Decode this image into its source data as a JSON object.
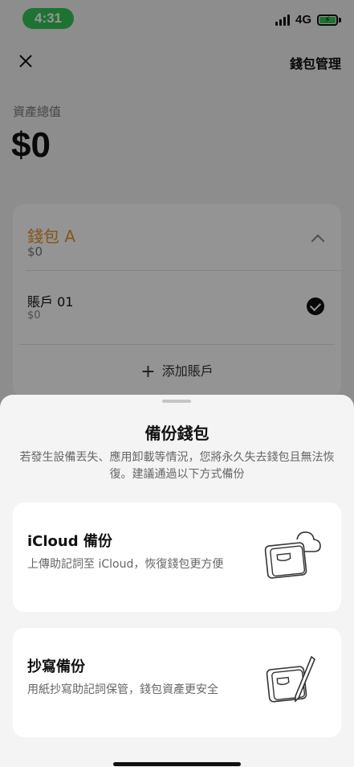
{
  "status_bar": {
    "time": "4:31",
    "network": "4G",
    "battery_charging_color": "#34c759"
  },
  "header": {
    "close_icon": "close-icon",
    "manage_label": "錢包管理"
  },
  "assets": {
    "label": "資產總值",
    "value": "$0"
  },
  "wallet": {
    "name": "錢包 A",
    "balance": "$0",
    "accounts": [
      {
        "name": "賬戶 01",
        "balance": "$0",
        "selected": true
      }
    ],
    "add_account_label": "添加賬戶",
    "accent_color": "#e8932b"
  },
  "sheet": {
    "title": "備份錢包",
    "description": "若發生設備丟失、應用卸載等情況，您將永久失去錢包且無法恢復。建議通過以下方式備份",
    "options": [
      {
        "title": "iCloud 備份",
        "subtitle": "上傳助記詞至 iCloud，恢復錢包更方便",
        "icon": "cloud-wallet-icon"
      },
      {
        "title": "抄寫備份",
        "subtitle": "用紙抄寫助記詞保管，錢包資產更安全",
        "icon": "pen-wallet-icon"
      }
    ]
  }
}
